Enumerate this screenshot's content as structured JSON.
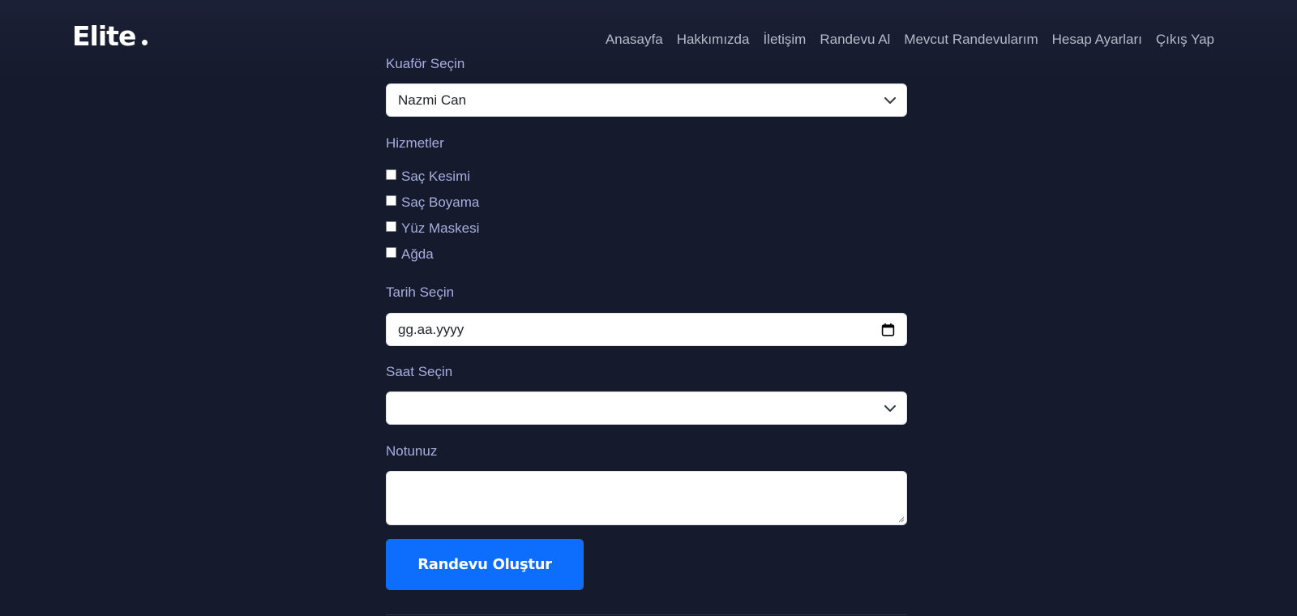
{
  "header": {
    "logo": "Elite",
    "nav": [
      "Anasayfa",
      "Hakkımızda",
      "İletişim",
      "Randevu Al",
      "Mevcut Randevularım",
      "Hesap Ayarları",
      "Çıkış Yap"
    ]
  },
  "form": {
    "barber_label": "Kuaför Seçin",
    "barber_selected": "Nazmi Can",
    "services_label": "Hizmetler",
    "services": [
      "Saç Kesimi",
      "Saç Boyama",
      "Yüz Maskesi",
      "Ağda"
    ],
    "services_checked": [
      false,
      false,
      false,
      false
    ],
    "date_label": "Tarih Seçin",
    "date_placeholder": "gg.aa.yyyy",
    "time_label": "Saat Seçin",
    "time_selected": "",
    "note_label": "Notunuz",
    "note_value": "",
    "submit_label": "Randevu Oluştur"
  },
  "colors": {
    "background": "#151a2c",
    "label": "#a7aede",
    "nav": "#b5bac9",
    "button": "#0d6efd"
  },
  "icons": [
    "chevron-down-icon",
    "calendar-icon",
    "resize-handle-icon"
  ]
}
